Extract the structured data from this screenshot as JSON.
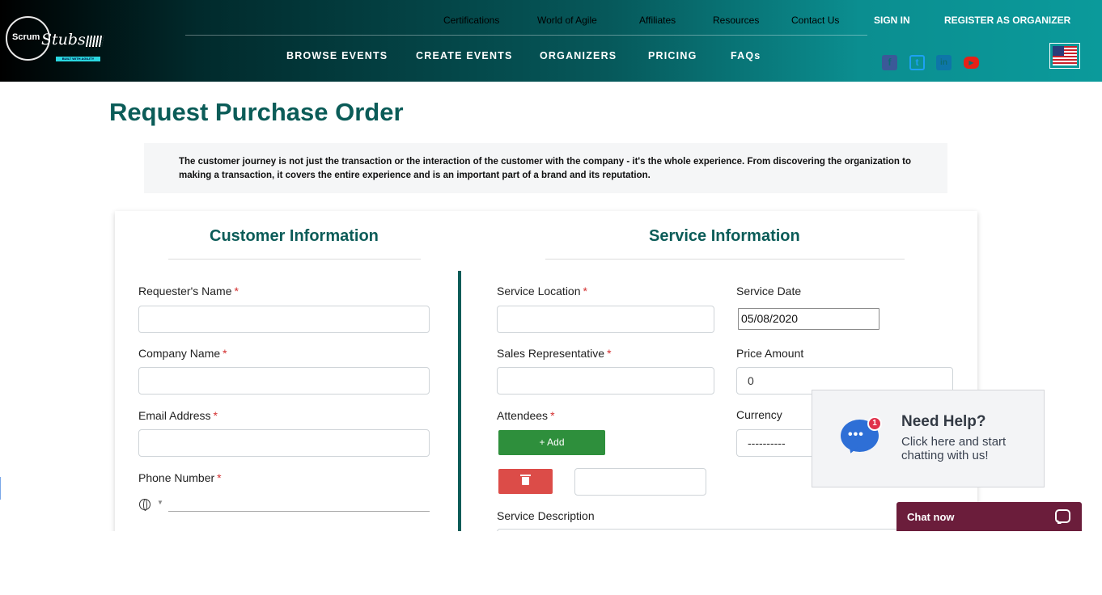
{
  "header": {
    "logo": {
      "wordmark": "Scrum",
      "script": "Stubs",
      "tagline": "BUILT WITH AGILITY"
    },
    "top_links": [
      "Certifications",
      "World of Agile",
      "Affiliates",
      "Resources",
      "Contact Us"
    ],
    "sign_in": "SIGN IN",
    "register": "REGISTER AS ORGANIZER",
    "main_nav": [
      "BROWSE EVENTS",
      "CREATE EVENTS",
      "ORGANIZERS",
      "PRICING",
      "FAQs"
    ],
    "social": [
      {
        "icon": "facebook-icon",
        "glyph": "f",
        "color": "#3b5998"
      },
      {
        "icon": "twitter-icon",
        "glyph": "t",
        "color": "#1da1f2"
      },
      {
        "icon": "linkedin-icon",
        "glyph": "in",
        "color": "#0e76a8"
      },
      {
        "icon": "youtube-icon",
        "glyph": "▶",
        "color": "#e62117"
      }
    ],
    "language_flag": "us-flag-icon"
  },
  "page": {
    "title": "Request Purchase Order",
    "intro": "The customer journey is not just the transaction or the interaction of the customer with the company - it's the whole experience. From discovering the organization to making a transaction, it covers the entire experience and is an important part of a brand and its reputation."
  },
  "customer": {
    "heading": "Customer Information",
    "requester_label": "Requester's Name",
    "company_label": "Company Name",
    "email_label": "Email Address",
    "phone_label": "Phone Number",
    "required_mark": "*"
  },
  "service": {
    "heading": "Service Information",
    "location_label": "Service Location",
    "date_label": "Service Date",
    "date_value": "05/08/2020",
    "sales_rep_label": "Sales Representative",
    "price_label": "Price Amount",
    "price_value": "0",
    "attendees_label": "Attendees",
    "add_button": "+ Add",
    "currency_label": "Currency",
    "currency_value": "----------",
    "description_label": "Service Description"
  },
  "chat": {
    "title": "Need Help?",
    "subtitle": "Click here and start chatting with us!",
    "badge_count": "1",
    "bar_label": "Chat now"
  },
  "colors": {
    "brand_teal": "#0b5c58",
    "add_green": "#2e8f3c",
    "delete_red": "#dc4c48",
    "chat_bar": "#6b1d3b",
    "required_red": "#d32f2f"
  }
}
